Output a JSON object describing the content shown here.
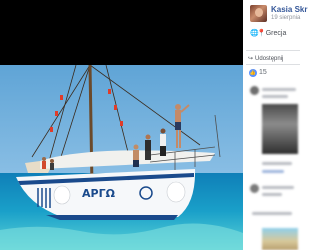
{
  "post": {
    "author": "Kasia Skr",
    "date": "19 sierpnia",
    "location": "Grecja",
    "privacy_icon": "globe-icon",
    "location_icon": "map-pin-icon"
  },
  "actions": {
    "share_label": "Udostępnij",
    "share_icon": "share-icon"
  },
  "reactions": {
    "icon": "thumbs-up-icon",
    "count": "15"
  },
  "photo": {
    "boat_name": "ΑΡΓΩ"
  }
}
